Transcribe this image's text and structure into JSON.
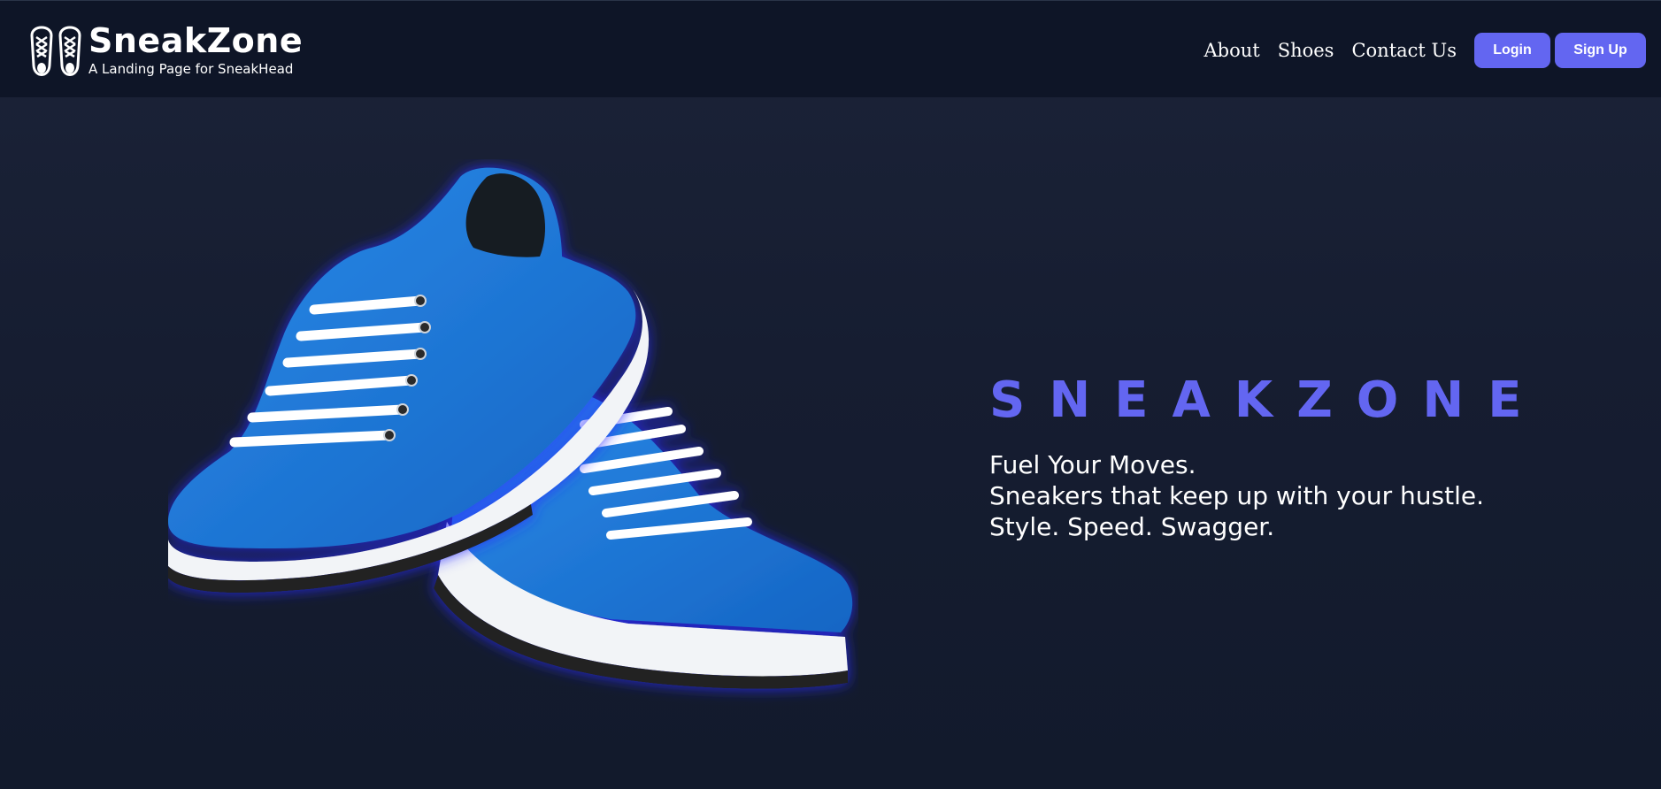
{
  "brand": {
    "name": "SneakZone",
    "tagline": "A Landing Page for SneakHead",
    "logo_icon": "sneakers-icon"
  },
  "nav": {
    "links": [
      "About",
      "Shoes",
      "Contact Us"
    ],
    "login_label": "Login",
    "signup_label": "Sign Up"
  },
  "hero": {
    "title": "SNEAKZONE",
    "lines": [
      "Fuel Your Moves.",
      "Sneakers that keep up with your hustle.",
      "Style. Speed. Swagger."
    ],
    "image": "blue-sneakers-pair"
  },
  "colors": {
    "accent": "#6366f1",
    "navbar_bg": "#0e1527",
    "page_bg": "#161d31",
    "shoe_blue": "#1e78d6"
  }
}
